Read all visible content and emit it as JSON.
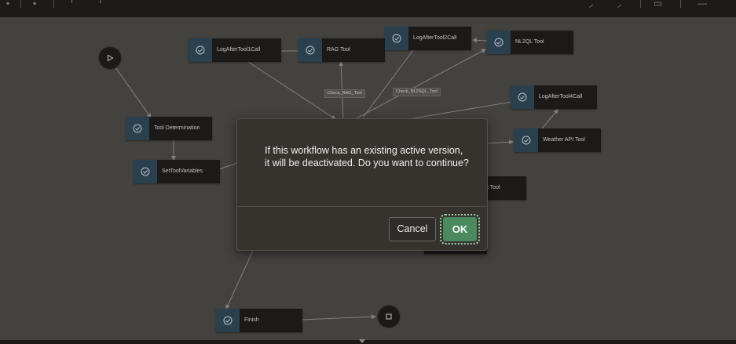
{
  "toolbar": {
    "icons": [
      "layout-icon",
      "hierarchy-icon",
      "connector-icon",
      "pointer-icon",
      "zoom-in-icon",
      "zoom-out-icon",
      "fit-screen-icon",
      "menu-icon"
    ]
  },
  "nodes": [
    {
      "id": "log1",
      "label": "LogAfterTool1Call"
    },
    {
      "id": "rag",
      "label": "RAG Tool"
    },
    {
      "id": "log2",
      "label": "LogAfterTool2Call"
    },
    {
      "id": "nl2ql",
      "label": "NL2QL Tool"
    },
    {
      "id": "log4",
      "label": "LogAfterTool4Call"
    },
    {
      "id": "weather",
      "label": "Weather API Tool"
    },
    {
      "id": "tooldet",
      "label": "Tool Determination"
    },
    {
      "id": "setvars",
      "label": "SetToolVariables"
    },
    {
      "id": "partial",
      "label": "t Tool"
    },
    {
      "id": "finish",
      "label": "Finish"
    }
  ],
  "edge_labels": {
    "check_rag": "Check_RAG_Tool",
    "check_nl2sql": "Check_NL2SQL_Tool"
  },
  "dialog": {
    "message": "If this workflow has an existing active version, it will be deactivated. Do you want to continue?",
    "cancel_label": "Cancel",
    "ok_label": "OK"
  },
  "colors": {
    "canvas": "#4a4845",
    "node_body": "#1e1d1c",
    "node_icon_bg": "#2e4656",
    "dialog_bg": "#36332f",
    "ok_button": "#4a8a5e"
  }
}
